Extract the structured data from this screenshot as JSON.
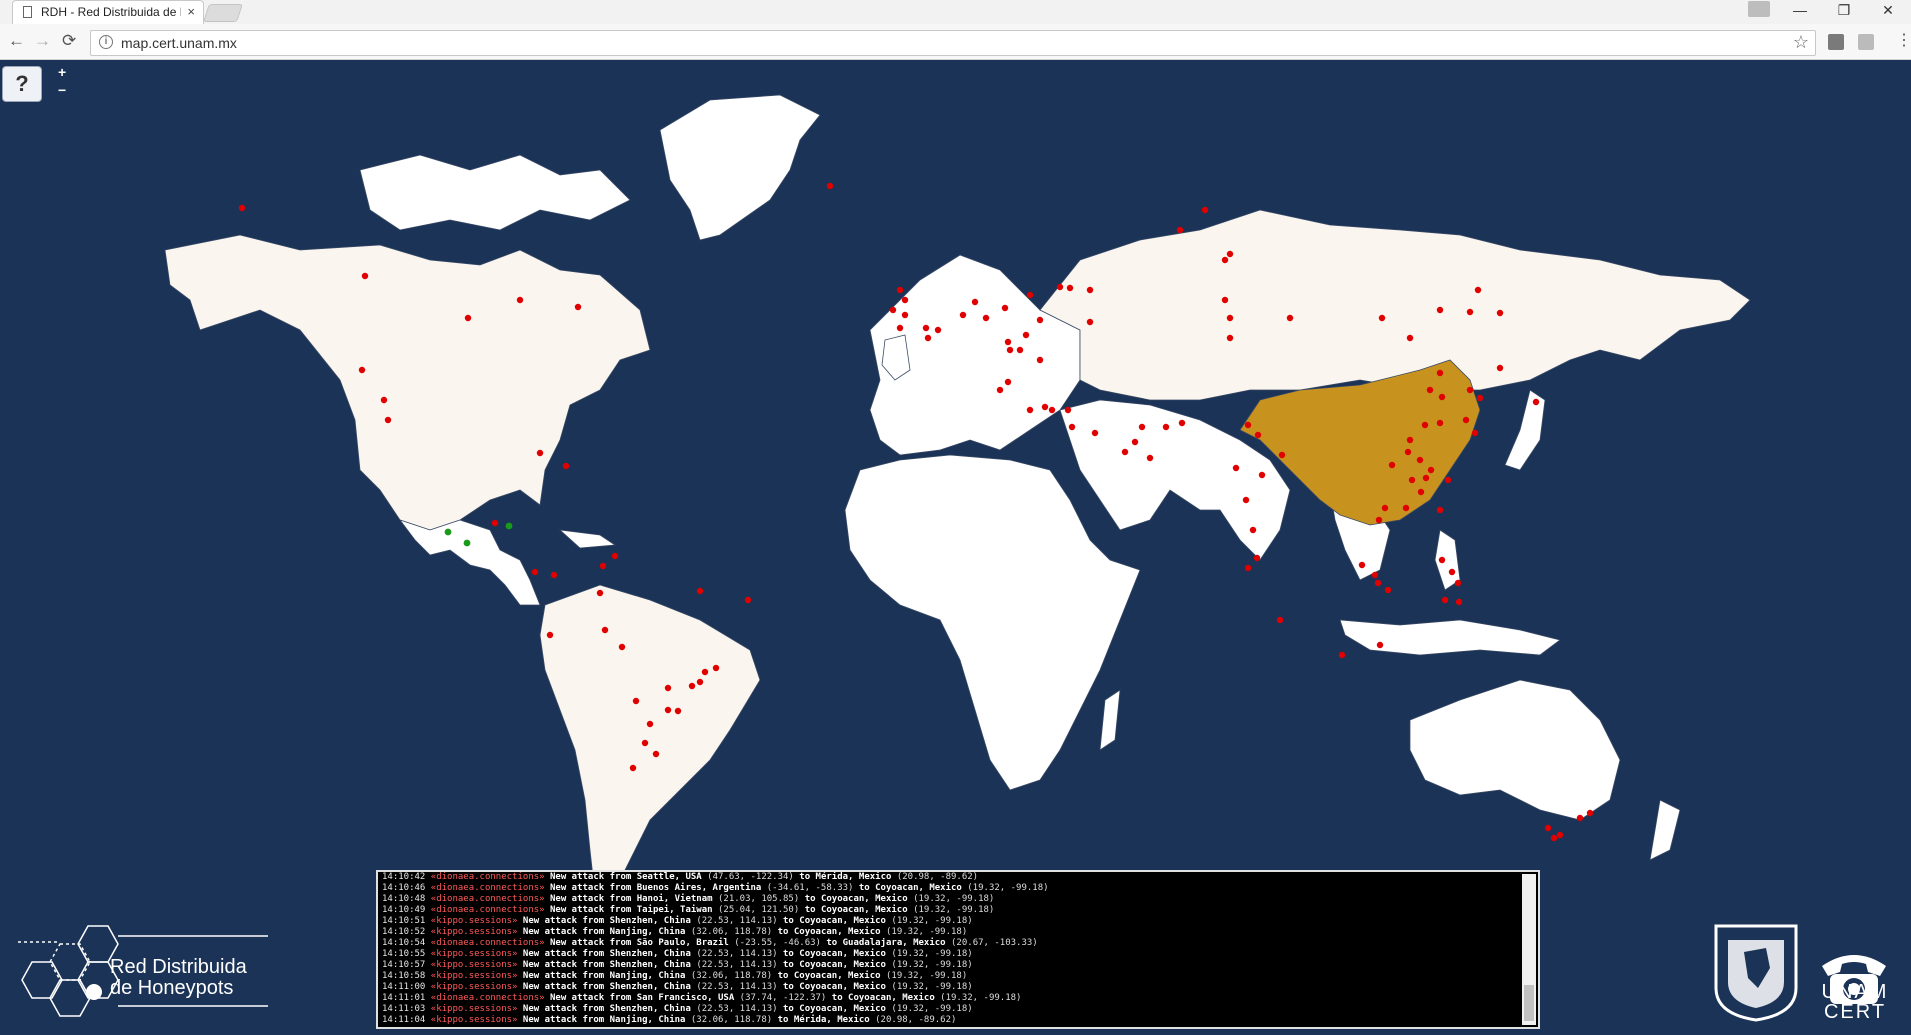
{
  "browser": {
    "tab_title": "RDH - Red Distribuida de Honeypots",
    "tab_close": "×",
    "url": "map.cert.unam.mx",
    "window_controls": {
      "minimize": "—",
      "restore": "❐",
      "close": "✕"
    },
    "nav": {
      "back": "←",
      "forward": "→",
      "reload": "⟳"
    }
  },
  "map": {
    "help_label": "?",
    "zoom_in_label": "+",
    "zoom_out_label": "−",
    "colors": {
      "ocean": "#1b3356",
      "land": "#ffffff",
      "visited_land": "#faf6ef",
      "highlight_country": "#c8921e",
      "attack_dot": "#e00000",
      "target_dot": "#1a9a1a"
    },
    "highlighted_countries": [
      "United States",
      "Brazil",
      "China"
    ]
  },
  "console": {
    "entries": [
      {
        "time": "14:10:42",
        "source": "dionaea.connections",
        "msg": "New attack from",
        "from": "Seattle, USA",
        "from_coords": "(47.63, -122.34)",
        "to": "Mérida, Mexico",
        "to_coords": "(20.98, -89.62)"
      },
      {
        "time": "14:10:46",
        "source": "dionaea.connections",
        "msg": "New attack from",
        "from": "Buenos Aires, Argentina",
        "from_coords": "(-34.61, -58.33)",
        "to": "Coyoacan, Mexico",
        "to_coords": "(19.32, -99.18)"
      },
      {
        "time": "14:10:48",
        "source": "dionaea.connections",
        "msg": "New attack from",
        "from": "Hanoi, Vietnam",
        "from_coords": "(21.03, 105.85)",
        "to": "Coyoacan, Mexico",
        "to_coords": "(19.32, -99.18)"
      },
      {
        "time": "14:10:49",
        "source": "dionaea.connections",
        "msg": "New attack from",
        "from": "Taipei, Taiwan",
        "from_coords": "(25.04, 121.50)",
        "to": "Coyoacan, Mexico",
        "to_coords": "(19.32, -99.18)"
      },
      {
        "time": "14:10:51",
        "source": "kippo.sessions",
        "msg": "New attack from",
        "from": "Shenzhen, China",
        "from_coords": "(22.53, 114.13)",
        "to": "Coyoacan, Mexico",
        "to_coords": "(19.32, -99.18)"
      },
      {
        "time": "14:10:52",
        "source": "kippo.sessions",
        "msg": "New attack from",
        "from": "Nanjing, China",
        "from_coords": "(32.06, 118.78)",
        "to": "Coyoacan, Mexico",
        "to_coords": "(19.32, -99.18)"
      },
      {
        "time": "14:10:54",
        "source": "dionaea.connections",
        "msg": "New attack from",
        "from": "São Paulo, Brazil",
        "from_coords": "(-23.55, -46.63)",
        "to": "Guadalajara, Mexico",
        "to_coords": "(20.67, -103.33)"
      },
      {
        "time": "14:10:55",
        "source": "kippo.sessions",
        "msg": "New attack from",
        "from": "Shenzhen, China",
        "from_coords": "(22.53, 114.13)",
        "to": "Coyoacan, Mexico",
        "to_coords": "(19.32, -99.18)"
      },
      {
        "time": "14:10:57",
        "source": "kippo.sessions",
        "msg": "New attack from",
        "from": "Shenzhen, China",
        "from_coords": "(22.53, 114.13)",
        "to": "Coyoacan, Mexico",
        "to_coords": "(19.32, -99.18)"
      },
      {
        "time": "14:10:58",
        "source": "kippo.sessions",
        "msg": "New attack from",
        "from": "Nanjing, China",
        "from_coords": "(32.06, 118.78)",
        "to": "Coyoacan, Mexico",
        "to_coords": "(19.32, -99.18)"
      },
      {
        "time": "14:11:00",
        "source": "kippo.sessions",
        "msg": "New attack from",
        "from": "Shenzhen, China",
        "from_coords": "(22.53, 114.13)",
        "to": "Coyoacan, Mexico",
        "to_coords": "(19.32, -99.18)"
      },
      {
        "time": "14:11:01",
        "source": "dionaea.connections",
        "msg": "New attack from",
        "from": "San Francisco, USA",
        "from_coords": "(37.74, -122.37)",
        "to": "Coyoacan, Mexico",
        "to_coords": "(19.32, -99.18)"
      },
      {
        "time": "14:11:03",
        "source": "kippo.sessions",
        "msg": "New attack from",
        "from": "Shenzhen, China",
        "from_coords": "(22.53, 114.13)",
        "to": "Coyoacan, Mexico",
        "to_coords": "(19.32, -99.18)"
      },
      {
        "time": "14:11:04",
        "source": "kippo.sessions",
        "msg": "New attack from",
        "from": "Nanjing, China",
        "from_coords": "(32.06, 118.78)",
        "to": "Mérida, Mexico",
        "to_coords": "(20.98, -89.62)"
      }
    ]
  },
  "branding": {
    "rdh_line1": "Red Distribuida",
    "rdh_line2": "de Honeypots",
    "cert_line1": "UNAM",
    "cert_line2": "CERT"
  }
}
